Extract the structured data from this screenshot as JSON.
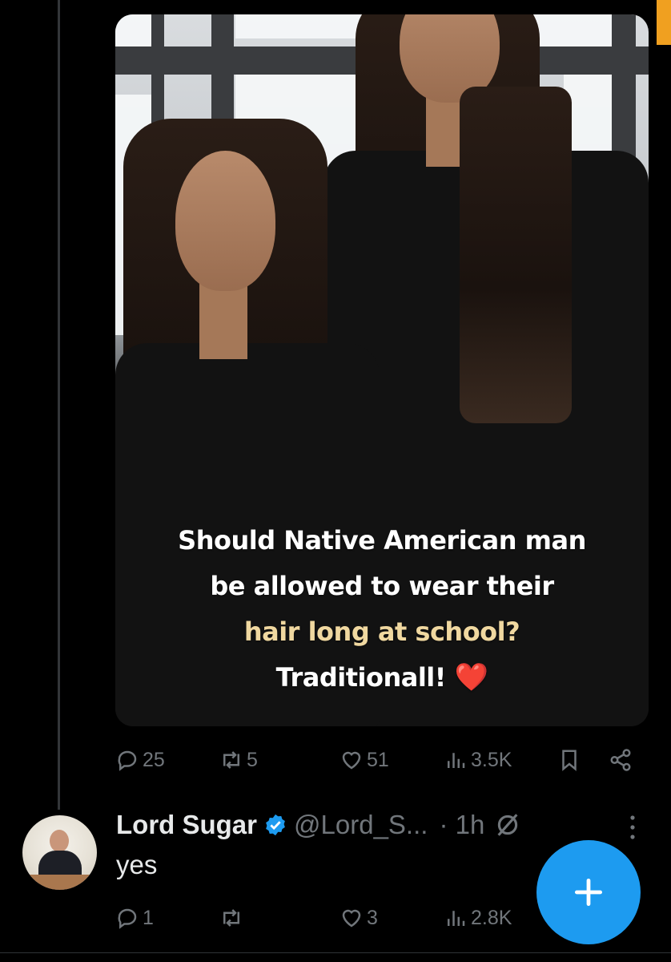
{
  "post": {
    "image_caption": {
      "line1": "Should Native American man",
      "line2": "be allowed to wear their",
      "line3": "hair long at school?",
      "line4": "Traditionall!",
      "emoji": "❤️"
    },
    "actions": {
      "replies": "25",
      "reposts": "5",
      "likes": "51",
      "views": "3.5K"
    }
  },
  "reply": {
    "name": "Lord Sugar",
    "verified": true,
    "handle": "@Lord_S...",
    "time": "· 1h",
    "text": "yes",
    "actions": {
      "replies": "1",
      "reposts": "",
      "likes": "3",
      "views": "2.8K"
    }
  },
  "icons": {
    "reply": "reply-icon",
    "repost": "repost-icon",
    "like": "heart-icon",
    "views": "views-icon",
    "bookmark": "bookmark-icon",
    "share": "share-icon",
    "compose": "plus-icon",
    "more": "more-icon",
    "grok": "grok-icon"
  },
  "colors": {
    "accent": "#1d9bf0",
    "muted": "#71767b",
    "text": "#e7e9ea",
    "background": "#000000"
  }
}
